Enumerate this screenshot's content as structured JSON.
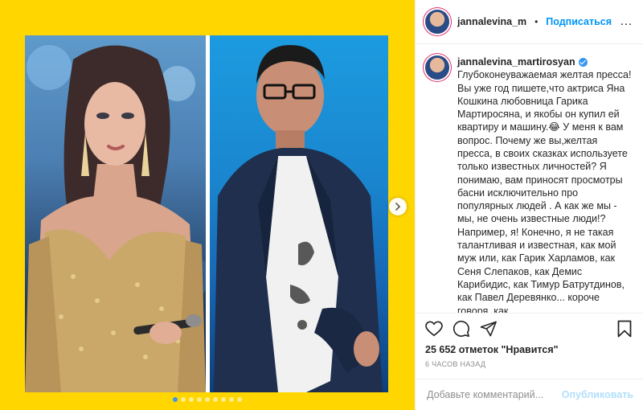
{
  "post": {
    "username": "jannalevina_martirosyan",
    "header_username": "jannalevina_martirosyan",
    "separator": "•",
    "follow_label": "Подписаться",
    "more_label": "…",
    "caption": "Глубоконеуважаемая желтая пресса! Вы уже год пишете,что актриса Яна Кошкина любовница Гарика Мартиросяна, и якобы он купил ей квартиру и машину.😂 У меня к вам вопрос. Почему же вы,желтая пресса, в своих сказках используете только известных личностей? Я понимаю, вам приносят просмотры басни исключительно про популярных людей . А как же мы - мы, не очень известные люди!? Например, я! Конечно, я не такая талантливая и известная, как мой муж или, как Гарик Харламов, как Сеня Слепаков, как Демис Карибидис, как Тимур Батрутдинов, как Павел Деревянко... короче говоря, как",
    "likes_text": "25 652 отметок \"Нравится\"",
    "time_text": "6 ЧАСОВ НАЗАД",
    "comment_placeholder": "Добавьте комментарий...",
    "publish_label": "Опубликовать"
  },
  "media": {
    "background_color": "#ffd600",
    "slide_count": 9,
    "active_slide": 1
  },
  "icons": {
    "like": "heart-icon",
    "comment": "comment-icon",
    "share": "paper-plane-icon",
    "save": "bookmark-icon",
    "next": "chevron-right-icon"
  },
  "colors": {
    "accent": "#0095f6",
    "verified": "#3897f0"
  }
}
